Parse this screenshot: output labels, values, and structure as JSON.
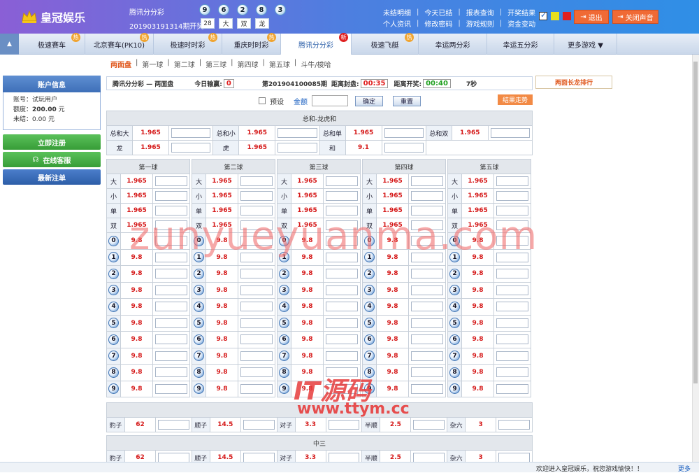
{
  "header": {
    "logo": "皇冠娱乐",
    "lottery_name": "腾讯分分彩",
    "draw_label": "201903191314期开奖",
    "balls": [
      "9",
      "6",
      "2",
      "8",
      "3"
    ],
    "results": [
      "28",
      "大",
      "双",
      "龙"
    ],
    "links_row1": [
      "未结明细",
      "今天已结",
      "报表查询",
      "开奖结果"
    ],
    "links_row2": [
      "个人资讯",
      "修改密码",
      "游戏规则",
      "资金变动"
    ],
    "logout": "退出",
    "mute": "关闭声音",
    "swatch_colors": [
      "#e8e020",
      "#e02020"
    ]
  },
  "nav": {
    "tabs": [
      {
        "label": "极速赛车",
        "badge": "热"
      },
      {
        "label": "北京赛车(PK10)",
        "badge": "热"
      },
      {
        "label": "极速时时彩",
        "badge": "热"
      },
      {
        "label": "重庆时时彩",
        "badge": "热"
      },
      {
        "label": "腾讯分分彩",
        "badge": "新"
      },
      {
        "label": "极速飞艇",
        "badge": "热"
      },
      {
        "label": "幸运两分彩",
        "badge": ""
      },
      {
        "label": "幸运五分彩",
        "badge": ""
      },
      {
        "label": "更多游戏 ▼",
        "badge": ""
      }
    ]
  },
  "subnav": [
    "两面盘",
    "第一球",
    "第二球",
    "第三球",
    "第四球",
    "第五球",
    "斗牛/梭哈"
  ],
  "sidebar": {
    "title": "账户信息",
    "account_label": "账号：",
    "account": "试玩用户",
    "quota_label": "额度：",
    "quota": "200.00",
    "quota_unit": "元",
    "unsettled_label": "未结：",
    "unsettled": "0.00",
    "unsettled_unit": "元",
    "register": "立即注册",
    "service": "在线客服",
    "latest": "最新注单"
  },
  "info": {
    "title": "腾讯分分彩 — 两面盘",
    "today_label": "今日输赢:",
    "today_value": "0",
    "period": "第201904100085期",
    "close_label": "距离封盘:",
    "close_time": "00:35",
    "draw_label": "距离开奖:",
    "draw_time": "00:40",
    "seconds": "7秒",
    "rank_label": "两面长龙排行"
  },
  "bet": {
    "preset": "预设",
    "amount_label": "金额",
    "confirm": "确定",
    "reset": "重置",
    "trend": "结果走势"
  },
  "sum_table": {
    "title": "总和-龙虎和",
    "row1": [
      [
        "总和大",
        "1.965"
      ],
      [
        "总和小",
        "1.965"
      ],
      [
        "总和单",
        "1.965"
      ],
      [
        "总和双",
        "1.965"
      ]
    ],
    "row2": [
      [
        "龙",
        "1.965"
      ],
      [
        "虎",
        "1.965"
      ],
      [
        "和",
        "9.1"
      ]
    ]
  },
  "balls_table": {
    "columns": [
      "第一球",
      "第二球",
      "第三球",
      "第四球",
      "第五球"
    ],
    "bs_labels": [
      "大",
      "小",
      "单",
      "双"
    ],
    "bs_odds": "1.965",
    "digits": [
      "0",
      "1",
      "2",
      "3",
      "4",
      "5",
      "6",
      "7",
      "8",
      "9"
    ],
    "digit_odds": "9.8"
  },
  "special_table": {
    "title_top": "",
    "items": [
      [
        "豹子",
        "62"
      ],
      [
        "顺子",
        "14.5"
      ],
      [
        "对子",
        "3.3"
      ],
      [
        "半顺",
        "2.5"
      ],
      [
        "杂六",
        "3"
      ]
    ]
  },
  "mid_table": {
    "title": "中三",
    "items": [
      [
        "豹子",
        "62"
      ],
      [
        "顺子",
        "14.5"
      ],
      [
        "对子",
        "3.3"
      ],
      [
        "半顺",
        "2.5"
      ],
      [
        "杂六",
        "3"
      ]
    ]
  },
  "footer": {
    "marquee": "欢迎进入皇冠娱乐，祝您游戏愉快！！",
    "more": "更多"
  },
  "watermark": {
    "line1": "zunyueyuanma.com",
    "line2": "IT源码",
    "line3": "www.ttym.cc"
  }
}
